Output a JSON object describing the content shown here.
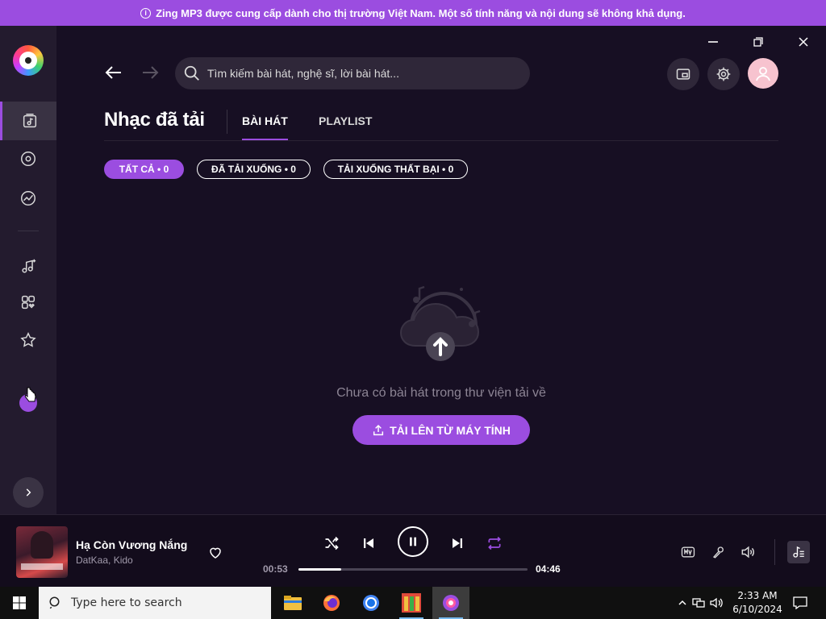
{
  "banner": {
    "text": "Zing MP3 được cung cấp dành cho thị trường Việt Nam. Một số tính năng và nội dung sẽ không khả dụng."
  },
  "header": {
    "search_placeholder": "Tìm kiếm bài hát, nghệ sĩ, lời bài hát..."
  },
  "page": {
    "title": "Nhạc đã tải"
  },
  "tabs": [
    {
      "label": "BÀI HÁT",
      "active": true
    },
    {
      "label": "PLAYLIST",
      "active": false
    }
  ],
  "filters": [
    {
      "label": "TẤT CẢ • 0",
      "active": true
    },
    {
      "label": "ĐÃ TẢI XUỐNG • 0",
      "active": false
    },
    {
      "label": "TẢI XUỐNG THẤT BẠI • 0",
      "active": false
    }
  ],
  "empty_state": {
    "message": "Chưa có bài hát trong thư viện tải về",
    "upload_label": "TẢI LÊN TỪ MÁY TÍNH"
  },
  "player": {
    "song_title": "Hạ Còn Vương Nắng",
    "artists": "DatKaa, Kido",
    "elapsed": "00:53",
    "duration": "04:46",
    "progress_fraction": 0.185,
    "state": "playing"
  },
  "taskbar": {
    "search_placeholder": "Type here to search",
    "time": "2:33 AM",
    "date": "6/10/2024"
  },
  "colors": {
    "accent": "#9b4de0",
    "background": "#170f23",
    "sidebar": "#231b2e",
    "player": "#130c1c"
  }
}
